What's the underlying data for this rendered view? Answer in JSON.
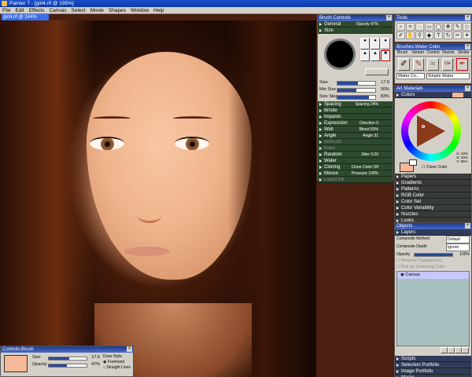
{
  "window": {
    "title": "Painter 7 - [girl4.rif @ 195%]"
  },
  "menu": [
    "File",
    "Edit",
    "Effects",
    "Canvas",
    "Select",
    "Movie",
    "Shapes",
    "Window",
    "Help"
  ],
  "document": {
    "tab": "girl4.rif @ 244%"
  },
  "brush_controls": {
    "title": "Brush Controls",
    "general": {
      "label": "General",
      "value": "Opacity 47%"
    },
    "size": {
      "label": "Size"
    },
    "size_slider": {
      "label": "Size",
      "value": "17.6"
    },
    "min_size": {
      "label": "Min Size",
      "value": "50%"
    },
    "size_step": {
      "label": "Size Step",
      "value": "83%"
    },
    "sections": [
      {
        "label": "Spacing",
        "value": "Spacing 24%"
      },
      {
        "label": "Bristle",
        "value": ""
      },
      {
        "label": "Impasto",
        "value": ""
      },
      {
        "label": "Expression",
        "value": "Direction 0"
      },
      {
        "label": "Well",
        "value": "Bleed 50%"
      },
      {
        "label": "Angle",
        "value": "Angle 31"
      },
      {
        "label": "Airbrush",
        "value": ""
      },
      {
        "label": "Rake",
        "value": ""
      },
      {
        "label": "Random",
        "value": "Jitter 0.00"
      },
      {
        "label": "Water",
        "value": ""
      },
      {
        "label": "Cloning",
        "value": "Clone Color Off"
      },
      {
        "label": "Mouse",
        "value": "Pressure 100%"
      },
      {
        "label": "Liquid Ink",
        "value": ""
      }
    ]
  },
  "tools": {
    "title": "Tools"
  },
  "brushes": {
    "title": "Brushes:Water Color",
    "tabs": [
      "Brush",
      "Variant",
      "Control",
      "Nozzle",
      "Stroke"
    ],
    "category": "Water Co...",
    "variant": "Simple Water"
  },
  "art_materials": {
    "title": "Art Materials",
    "colors": "Colors",
    "clone_color": "Clone Color",
    "readout": [
      "H: 10%",
      "S: 33%",
      "V: 86%"
    ],
    "sections": [
      "Papers",
      "Gradients",
      "Patterns",
      "RGB Color",
      "Color Set",
      "Color Variability",
      "Nozzles",
      "Looks"
    ]
  },
  "objects": {
    "title": "Objects",
    "layers": "Layers",
    "composite_method_label": "Composite Method",
    "composite_method": "Default",
    "composite_depth_label": "Composite Depth",
    "composite_depth": "Ignore",
    "opacity_label": "Opacity",
    "opacity_value": "100%",
    "preserve": "Preserve Transparency",
    "pickup": "Pick Up Underlying Color",
    "canvas_layer": "Canvas",
    "sections": [
      "Scripts",
      "Selection Portfolio",
      "Image Portfolio",
      "Masks"
    ]
  },
  "controls_brush": {
    "title": "Controls:Brush",
    "size_label": "Size",
    "size_value": "17.6",
    "opacity_label": "Opacity",
    "opacity_value": "47%",
    "draw_style": "Draw Style",
    "freehand": "Freehand",
    "straight": "Straight Lines"
  },
  "colors": {
    "primary": "#f5b898",
    "secondary": "#ffffff",
    "accent": "#1c3a8a"
  },
  "levels": {
    "opacity": 0.47,
    "size": 0.55,
    "min_size": 0.5,
    "size_step": 0.83,
    "layer_opacity": 1.0
  }
}
